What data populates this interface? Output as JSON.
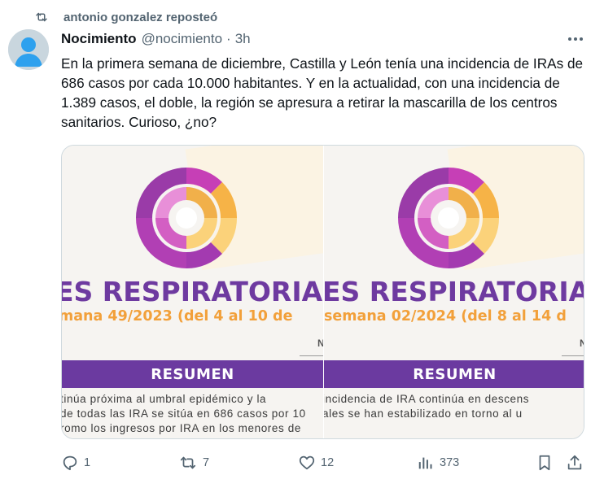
{
  "repost": {
    "text": "antonio gonzalez reposteó"
  },
  "tweet": {
    "name": "Nocimiento",
    "handle": "@nocimiento",
    "separator": "·",
    "time": "3h",
    "text": "En la primera semana de diciembre, Castilla y León tenía una incidencia de IRAs de 686 casos por cada 10.000 habitantes. Y en la actualidad, con una incidencia de 1.389 casos, el doble, la región se apresura a retirar la mascarilla de los centros sanitarios. Curioso, ¿no?"
  },
  "media": {
    "left": {
      "title": "ES RESPIRATORIAS",
      "week": "mana 49/2023 (del 4 al 10 de",
      "marker": "N",
      "band": "RESUMEN",
      "lines": [
        "tinúa próxima al umbral epidémico y la",
        "de todas las IRA se sitúa en 686 casos por 10",
        "romo los ingresos por IRA en los menores de"
      ]
    },
    "right": {
      "title": "ES RESPIRATORIAS",
      "week": "semana 02/2024 (del 8 al 14 d",
      "marker": "N",
      "band": "RESUMEN",
      "lines": [
        "incidencia de IRA continúa en descens",
        "ales se han estabilizado en torno al u"
      ]
    }
  },
  "actions": {
    "replies": "1",
    "reposts": "7",
    "likes": "12",
    "views": "373"
  },
  "colors": {
    "purple": "#6b3aa0",
    "orange": "#f2a03a",
    "muted": "#536471",
    "repost_green": "#536471"
  }
}
